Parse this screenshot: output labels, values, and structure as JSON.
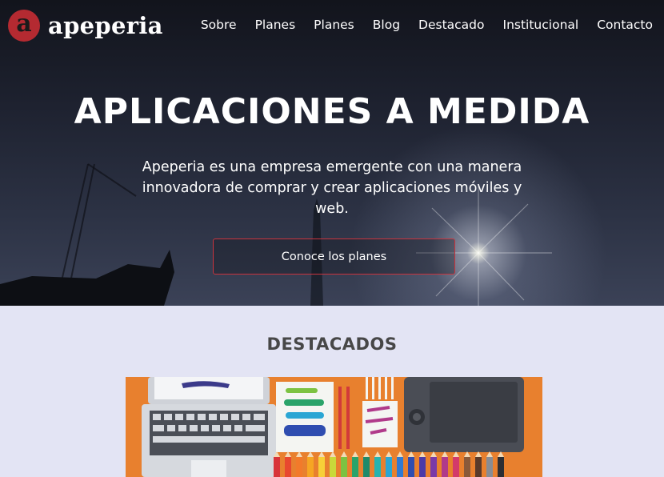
{
  "brand": {
    "name": "apeperia",
    "mark": "a",
    "color": "#b42a31"
  },
  "nav": {
    "items": [
      "Sobre",
      "Planes",
      "Planes",
      "Blog",
      "Destacado",
      "Institucional",
      "Contacto"
    ]
  },
  "hero": {
    "title": "APLICACIONES A MEDIDA",
    "subtitle": "Apeperia es una empresa emergente con una manera innovadora de comprar y crear aplicaciones móviles y web.",
    "cta_label": "Conoce los planes",
    "cta_border_color": "#c9333d"
  },
  "featured": {
    "title": "DESTACADOS",
    "image_icon": "art-supplies-illustration",
    "background_color": "#e3e4f4",
    "image_accent": "#e8802e"
  }
}
